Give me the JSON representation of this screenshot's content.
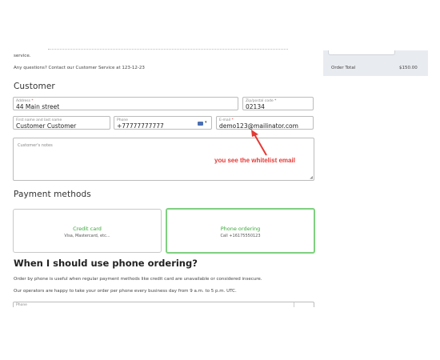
{
  "top": {
    "service_text": "service.",
    "contact_text": "Any questions? Contact our Customer Service at 123-12-23"
  },
  "customer": {
    "heading": "Customer",
    "address": {
      "label": "Address",
      "value": "44 Main street"
    },
    "zip": {
      "label": "Zip/postal code",
      "value": "02134"
    },
    "name": {
      "label": "First name and last name",
      "value": "Customer Customer"
    },
    "phone": {
      "label": "Phone",
      "value": "+77777777777",
      "flag_icon": "flag-icon"
    },
    "email": {
      "label": "E-mail",
      "value": "demo123@mailinator.com"
    },
    "notes": {
      "label": "Customer's notes",
      "value": ""
    },
    "required_mark": "*"
  },
  "annotation": {
    "text": "you see the whitelist email",
    "color": "#e53935"
  },
  "payment": {
    "heading": "Payment methods",
    "methods": [
      {
        "title": "Credit card",
        "subtitle": "Visa, Mastercard, etc...",
        "selected": false
      },
      {
        "title": "Phone ordering",
        "subtitle": "Call +16175550123",
        "selected": true
      }
    ]
  },
  "phone_ordering_info": {
    "heading": "When I should use phone ordering?",
    "para1": "Order by phone is useful when regular payment methods like credit card are unavailable or considered insecure.",
    "para2": "Our operators are happy to take your order per phone every business day from 9 a.m. to 5 p.m. UTC.",
    "phone_field_label": "Phone"
  },
  "summary": {
    "order_total_label": "Order Total",
    "order_total_value": "$150.00"
  },
  "colors": {
    "accent_green": "#3aa83a",
    "selected_border": "#7fd07f",
    "annotation_red": "#e53935"
  }
}
